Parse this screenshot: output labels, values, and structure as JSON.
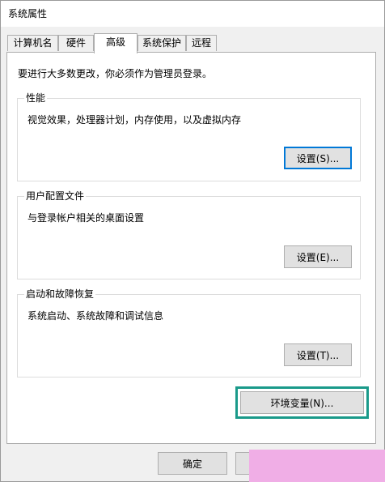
{
  "window": {
    "title": "系统属性"
  },
  "tabs": [
    {
      "label": "计算机名"
    },
    {
      "label": "硬件"
    },
    {
      "label": "高级",
      "active": true
    },
    {
      "label": "系统保护"
    },
    {
      "label": "远程"
    }
  ],
  "admin_note": "要进行大多数更改，你必须作为管理员登录。",
  "performance": {
    "title": "性能",
    "description": "视觉效果，处理器计划，内存使用，以及虚拟内存",
    "button": "设置(S)..."
  },
  "user_profiles": {
    "title": "用户配置文件",
    "description": "与登录帐户相关的桌面设置",
    "button": "设置(E)..."
  },
  "startup_recovery": {
    "title": "启动和故障恢复",
    "description": "系统启动、系统故障和调试信息",
    "button": "设置(T)..."
  },
  "env_button": "环境变量(N)...",
  "footer": {
    "ok": "确定"
  },
  "colors": {
    "focus_border": "#0078d7",
    "highlight_box": "#1a9a8a",
    "overlay": "#f0aee6"
  }
}
